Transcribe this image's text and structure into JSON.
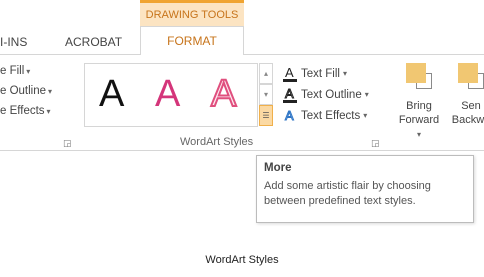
{
  "contextual_tab": {
    "label": "DRAWING TOOLS"
  },
  "tabs": {
    "addins": "I-INS",
    "acrobat": "ACROBAT",
    "format": "FORMAT"
  },
  "left_group": {
    "items": [
      "e Fill",
      "e Outline",
      "e Effects"
    ]
  },
  "wordart_styles": {
    "samples": [
      "A",
      "A",
      "A"
    ],
    "label": "WordArt Styles",
    "colors": {
      "style1": "#111111",
      "style2": "#d4357a",
      "style3_stroke": "#e04f7e"
    }
  },
  "text_commands": {
    "fill": "Text Fill",
    "outline": "Text Outline",
    "effects": "Text Effects"
  },
  "arrange": {
    "bring_line1": "Bring",
    "bring_line2": "Forward",
    "send_line1": "Sen",
    "send_line2": "Backwa"
  },
  "tooltip": {
    "title": "More",
    "body": "Add some artistic flair by choosing between predefined text styles."
  },
  "caption": "WordArt Styles",
  "accent_color": "#c7741b"
}
